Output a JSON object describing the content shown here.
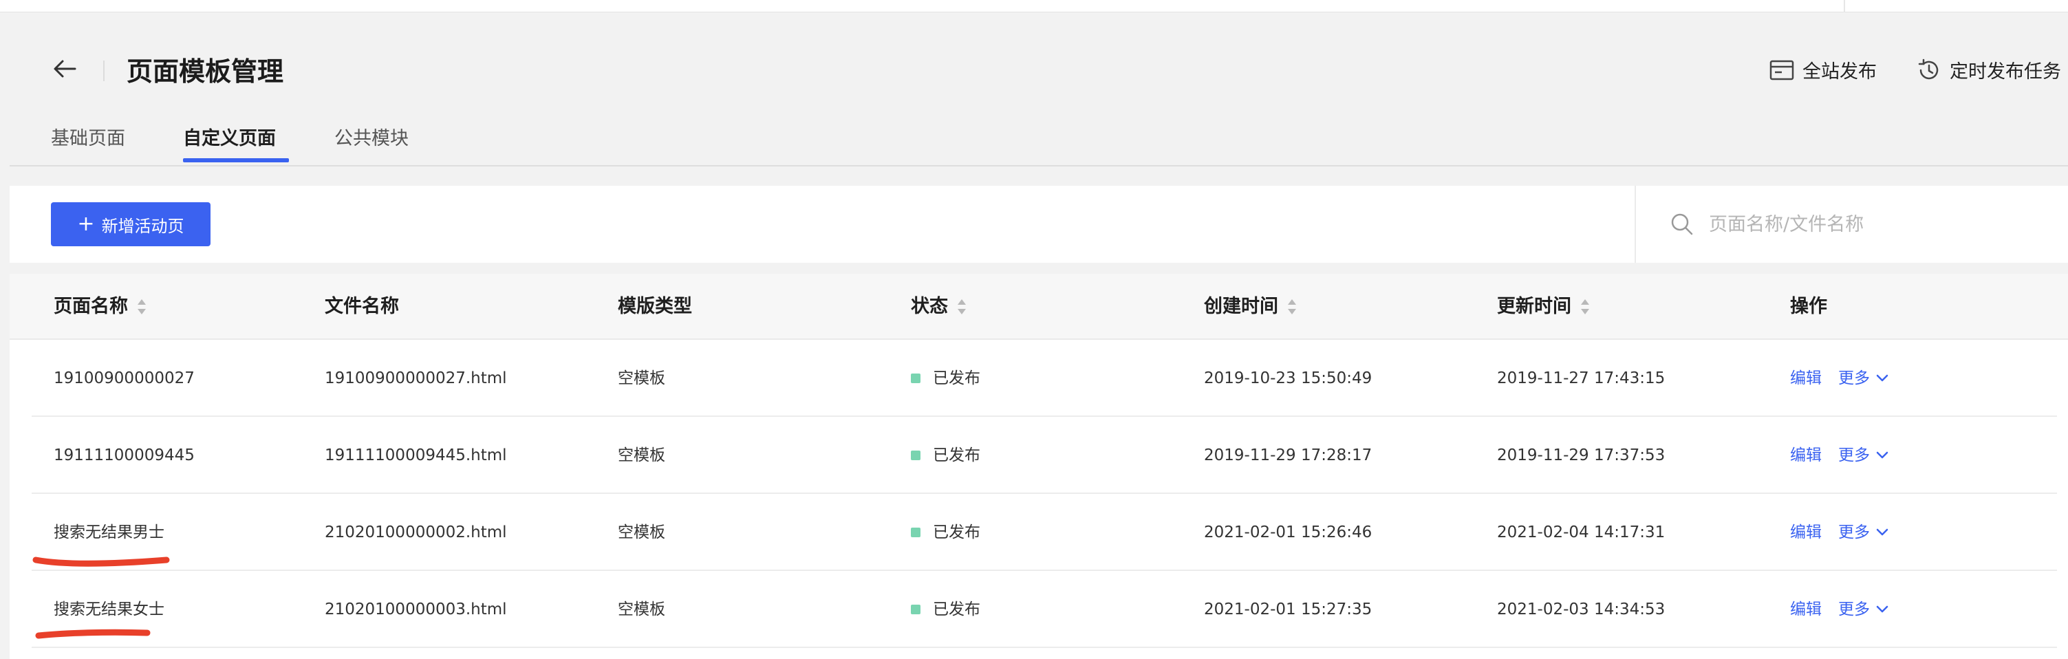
{
  "header": {
    "title": "页面模板管理",
    "back_icon": "arrow-left-icon",
    "actions": [
      {
        "label": "全站发布",
        "icon": "browser-window-icon"
      },
      {
        "label": "定时发布任务",
        "icon": "clock-history-icon"
      }
    ]
  },
  "tabs": [
    {
      "label": "基础页面",
      "active": false
    },
    {
      "label": "自定义页面",
      "active": true
    },
    {
      "label": "公共模块",
      "active": false
    }
  ],
  "toolbar": {
    "add_label": "新增活动页",
    "search_placeholder": "页面名称/文件名称"
  },
  "table": {
    "columns": [
      "页面名称",
      "文件名称",
      "模版类型",
      "状态",
      "创建时间",
      "更新时间",
      "操作"
    ],
    "rows": [
      {
        "name": "19100900000027",
        "file": "19100900000027.html",
        "type": "空模板",
        "status": "已发布",
        "created": "2019-10-23 15:50:49",
        "updated": "2019-11-27 17:43:15",
        "edit": "编辑",
        "more": "更多"
      },
      {
        "name": "19111100009445",
        "file": "19111100009445.html",
        "type": "空模板",
        "status": "已发布",
        "created": "2019-11-29 17:28:17",
        "updated": "2019-11-29 17:37:53",
        "edit": "编辑",
        "more": "更多"
      },
      {
        "name": "搜索无结果男士",
        "file": "21020100000002.html",
        "type": "空模板",
        "status": "已发布",
        "created": "2021-02-01 15:26:46",
        "updated": "2021-02-04 14:17:31",
        "edit": "编辑",
        "more": "更多"
      },
      {
        "name": "搜索无结果女士",
        "file": "21020100000003.html",
        "type": "空模板",
        "status": "已发布",
        "created": "2021-02-01 15:27:35",
        "updated": "2021-02-03 14:34:53",
        "edit": "编辑",
        "more": "更多"
      }
    ]
  },
  "colors": {
    "accent": "#3b62f0",
    "status_published": "#79d4b0",
    "annotation": "#e8402a"
  }
}
